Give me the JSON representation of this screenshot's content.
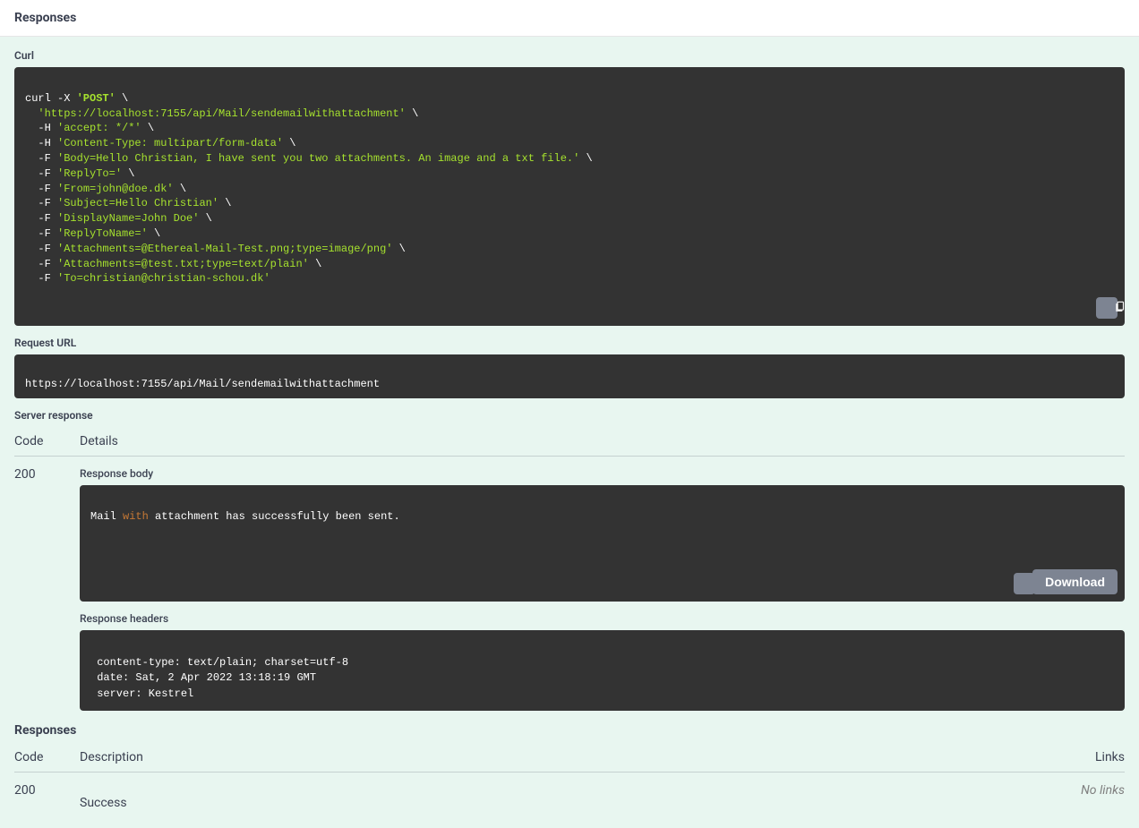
{
  "header": {
    "title": "Responses"
  },
  "curl": {
    "label": "Curl",
    "command_html": "curl -X <span class='meth'>'POST'</span> \\\n  <span class='str'>'https://localhost:7155/api/Mail/sendemailwithattachment'</span> \\\n  -H <span class='str'>'accept: */*'</span> \\\n  -H <span class='str'>'Content-Type: multipart/form-data'</span> \\\n  -F <span class='str'>'Body=Hello Christian, I have sent you two attachments. An image and a txt file.'</span> \\\n  -F <span class='str'>'ReplyTo='</span> \\\n  -F <span class='str'>'From=john@doe.dk'</span> \\\n  -F <span class='str'>'Subject=Hello Christian'</span> \\\n  -F <span class='str'>'DisplayName=John Doe'</span> \\\n  -F <span class='str'>'ReplyToName='</span> \\\n  -F <span class='str'>'Attachments=@Ethereal-Mail-Test.png;type=image/png'</span> \\\n  -F <span class='str'>'Attachments=@test.txt;type=text/plain'</span> \\\n  -F <span class='str'>'To=christian@christian-schou.dk'</span>"
  },
  "request_url": {
    "label": "Request URL",
    "value": "https://localhost:7155/api/Mail/sendemailwithattachment"
  },
  "server_response": {
    "label": "Server response",
    "columns": {
      "code": "Code",
      "details": "Details"
    },
    "row": {
      "code": "200",
      "response_body_label": "Response body",
      "response_body_html": "Mail <span class='hl'>with</span> attachment has successfully been sent.",
      "download_label": "Download",
      "response_headers_label": "Response headers",
      "response_headers": " content-type: text/plain; charset=utf-8 \n date: Sat, 2 Apr 2022 13:18:19 GMT \n server: Kestrel "
    }
  },
  "responses_section": {
    "title": "Responses",
    "columns": {
      "code": "Code",
      "description": "Description",
      "links": "Links"
    },
    "row": {
      "code": "200",
      "description": "Success",
      "links": "No links"
    }
  }
}
